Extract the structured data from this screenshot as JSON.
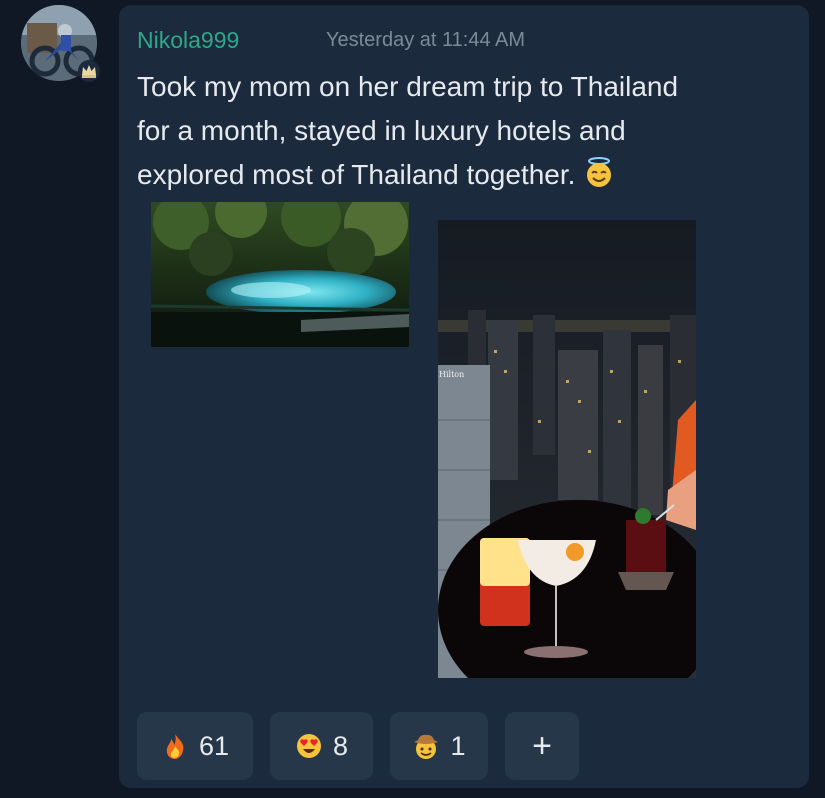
{
  "post": {
    "username": "Nikola999",
    "timestamp": "Yesterday at 11:44 AM",
    "message_lines": [
      "Took my mom on her dream trip to Thailand",
      "for a month, stayed in luxury hotels and",
      "explored most of Thailand together."
    ],
    "message_emoji": "smiling-face-with-halo-icon",
    "photos": [
      {
        "name": "jungle-lagoon-photo"
      },
      {
        "name": "rooftop-bar-night-photo",
        "sign_text": "Hilton"
      }
    ]
  },
  "reactions": [
    {
      "icon": "fire-icon",
      "count": "61"
    },
    {
      "icon": "heart-eyes-icon",
      "count": "8"
    },
    {
      "icon": "cowboy-face-icon",
      "count": "1"
    }
  ],
  "add_reaction_label": "+",
  "colors": {
    "background": "#0f1824",
    "card": "#1b2a3c",
    "username": "#2fa88a",
    "timestamp": "#7c8a98",
    "text": "#e6eaee",
    "reaction_bg": "#26374a"
  }
}
